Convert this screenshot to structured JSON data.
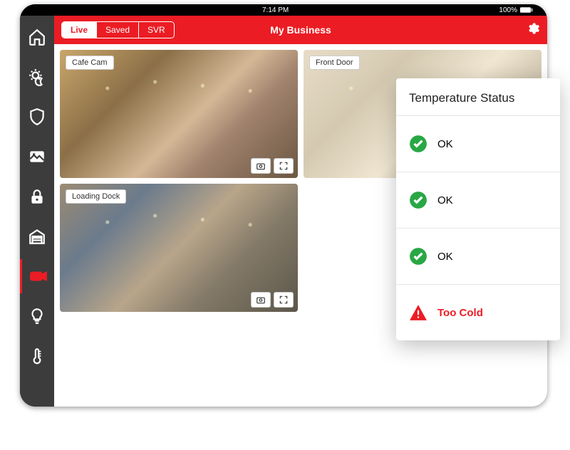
{
  "statusbar": {
    "time": "7:14 PM",
    "battery": "100%"
  },
  "header": {
    "title": "My Business",
    "tabs": [
      {
        "label": "Live",
        "active": true
      },
      {
        "label": "Saved",
        "active": false
      },
      {
        "label": "SVR",
        "active": false
      }
    ]
  },
  "sidebar": {
    "items": [
      {
        "name": "home"
      },
      {
        "name": "scenes"
      },
      {
        "name": "security"
      },
      {
        "name": "images"
      },
      {
        "name": "locks"
      },
      {
        "name": "garage"
      },
      {
        "name": "video",
        "active": true
      },
      {
        "name": "lights"
      },
      {
        "name": "thermostat"
      }
    ]
  },
  "cameras": [
    {
      "label": "Cafe Cam",
      "style": "cafe"
    },
    {
      "label": "Front Door",
      "style": "front"
    },
    {
      "label": "Loading Dock",
      "style": "dock"
    }
  ],
  "tempPanel": {
    "title": "Temperature Status",
    "rows": [
      {
        "status": "ok",
        "label": "OK"
      },
      {
        "status": "ok",
        "label": "OK"
      },
      {
        "status": "ok",
        "label": "OK"
      },
      {
        "status": "warn",
        "label": "Too Cold"
      }
    ]
  }
}
